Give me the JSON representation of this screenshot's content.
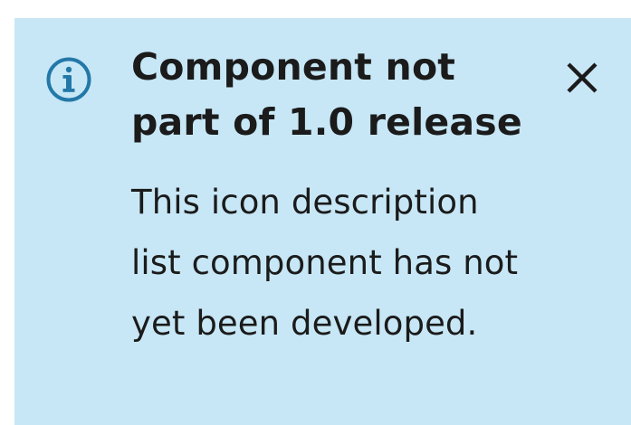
{
  "alert": {
    "icon": "info-icon",
    "title": "Component not part of 1.0 release",
    "body": "This icon description list component has not yet been developed.",
    "close_icon": "close-icon",
    "colors": {
      "background": "#c7e7f6",
      "icon": "#2378a8",
      "text": "#1b1b1b"
    }
  }
}
